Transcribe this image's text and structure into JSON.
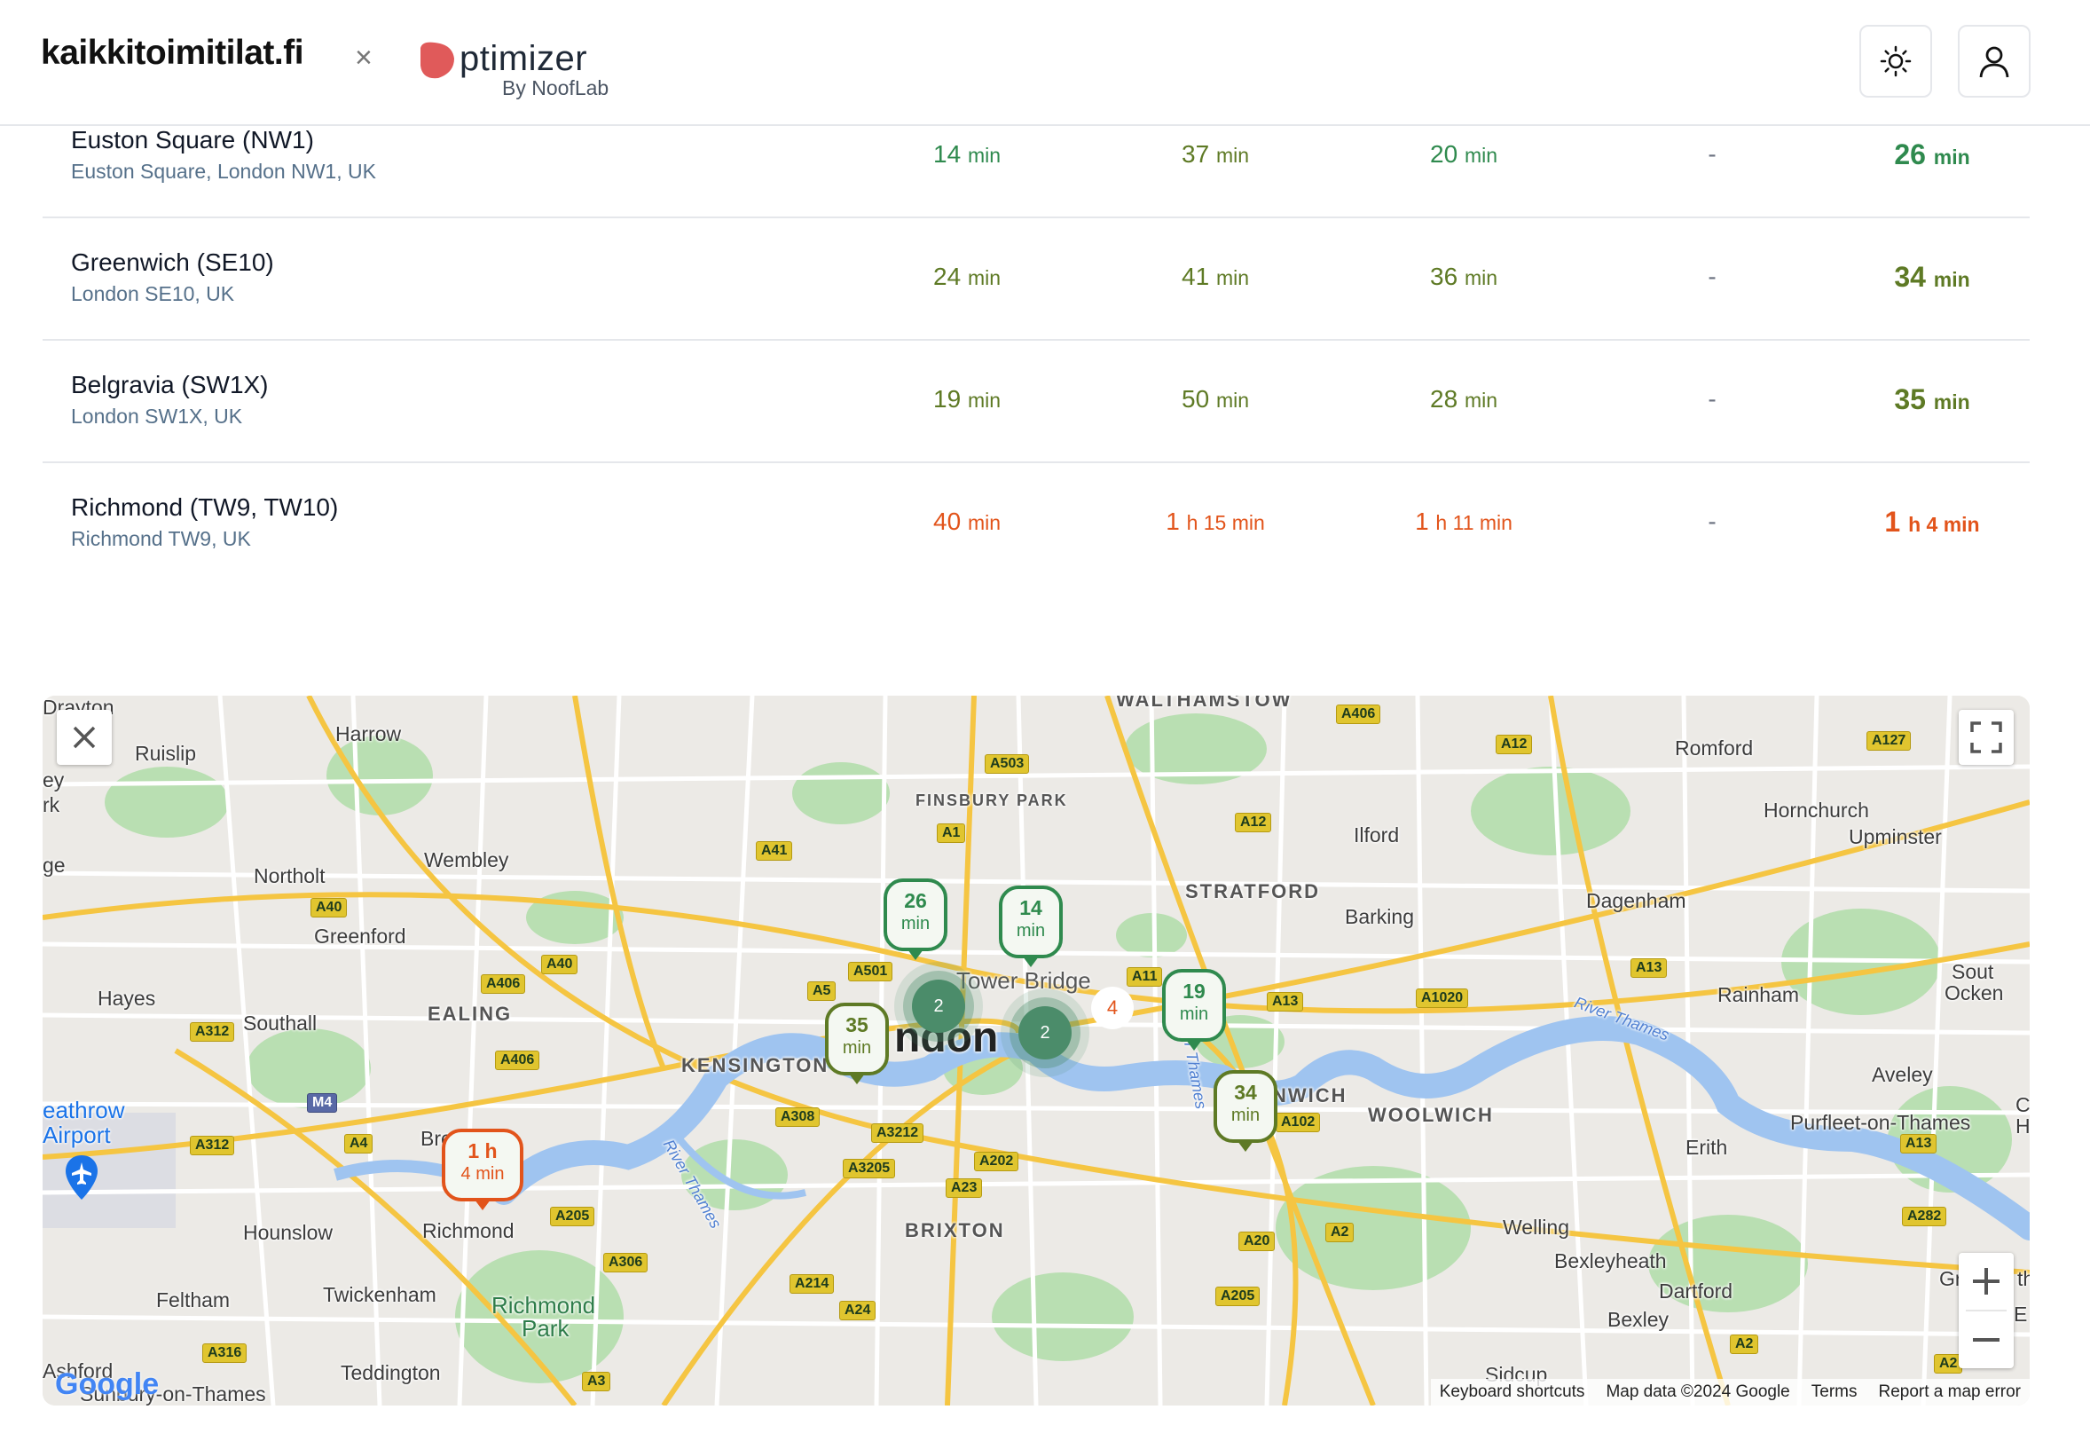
{
  "header": {
    "brand": "kaikkitoimitilat.fi",
    "separator": "×",
    "partner_name": "ptimizer",
    "partner_sub": "By NoofLab"
  },
  "rows": [
    {
      "name": "Euston Square (NW1)",
      "address": "Euston Square, London NW1, UK",
      "c1": "14",
      "c2": "37",
      "c3": "20",
      "c4": "-",
      "total": "26",
      "unit": "min"
    },
    {
      "name": "Greenwich (SE10)",
      "address": "London SE10, UK",
      "c1": "24",
      "c2": "41",
      "c3": "36",
      "c4": "-",
      "total": "34",
      "unit": "min"
    },
    {
      "name": "Belgravia (SW1X)",
      "address": "London SW1X, UK",
      "c1": "19",
      "c2": "50",
      "c3": "28",
      "c4": "-",
      "total": "35",
      "unit": "min"
    },
    {
      "name": "Richmond (TW9, TW10)",
      "address": "Richmond TW9, UK",
      "c1": "40",
      "c2a": "1",
      "c2b": "h 15 min",
      "c3a": "1",
      "c3b": "h 11 min",
      "c4": "-",
      "total_a": "1",
      "total_b": "h 4 min",
      "unit": "min"
    }
  ],
  "map": {
    "labels": {
      "walthamstow": "WALTHAMSTOW",
      "harrow": "Harrow",
      "ruislip": "Ruislip",
      "romford": "Romford",
      "hornchurch": "Hornchurch",
      "upminster": "Upminster",
      "finsbury": "FINSBURY PARK",
      "ilford": "Ilford",
      "northolt": "Northolt",
      "wembley": "Wembley",
      "stratford": "STRATFORD",
      "barking": "Barking",
      "dagenham": "Dagenham",
      "greenford": "Greenford",
      "towerbridge": "Tower Bridge",
      "hayes": "Hayes",
      "southall": "Southall",
      "ealing": "EALING",
      "london": "ndon",
      "rainham": "Rainham",
      "drayton": "Drayton",
      "kensington": "KENSINGTON",
      "woolwich": "WOOLWICH",
      "nwich": "NWICH",
      "aveley": "Aveley",
      "heathrow": "eathrow",
      "airport": "Airport",
      "purfleet": "Purfleet-on-Thames",
      "erith": "Erith",
      "hounslow": "Hounslow",
      "richmond": "Richmond",
      "brixton": "BRIXTON",
      "welling": "Welling",
      "bexleyheath": "Bexleyheath",
      "richmondpark": "Richmond",
      "richmondpark2": "Park",
      "feltham": "Feltham",
      "twickenham": "Twickenham",
      "dartford": "Dartford",
      "bexley": "Bexley",
      "teddington": "Teddington",
      "sidcup": "Sidcup",
      "ashford": "Ashford",
      "sunbury": "Sunbury-on-Thames",
      "river1": "River Thames",
      "river2": "River Thames",
      "river3": "River Thames",
      "south": "Sout",
      "ockenden": "Ocken",
      "bre": "Bre",
      "ey": "ey",
      "rk": "rk",
      "ge": "ge",
      "gr": "Gr",
      "th": "th",
      "e": "E",
      "c": "C",
      "h": "H"
    },
    "markers": [
      {
        "top": "26",
        "unit": "min",
        "tone": "g"
      },
      {
        "top": "14",
        "unit": "min",
        "tone": "g"
      },
      {
        "top": "19",
        "unit": "min",
        "tone": "g"
      },
      {
        "top": "35",
        "unit": "min",
        "tone": "o"
      },
      {
        "top": "34",
        "unit": "min",
        "tone": "o"
      },
      {
        "top": "1 h",
        "unit": "4 min",
        "tone": "r"
      }
    ],
    "clusters": [
      "2",
      "2",
      "4"
    ],
    "attribution": [
      "Keyboard shortcuts",
      "Map data ©2024 Google",
      "Terms",
      "Report a map error"
    ],
    "google": "Google"
  }
}
